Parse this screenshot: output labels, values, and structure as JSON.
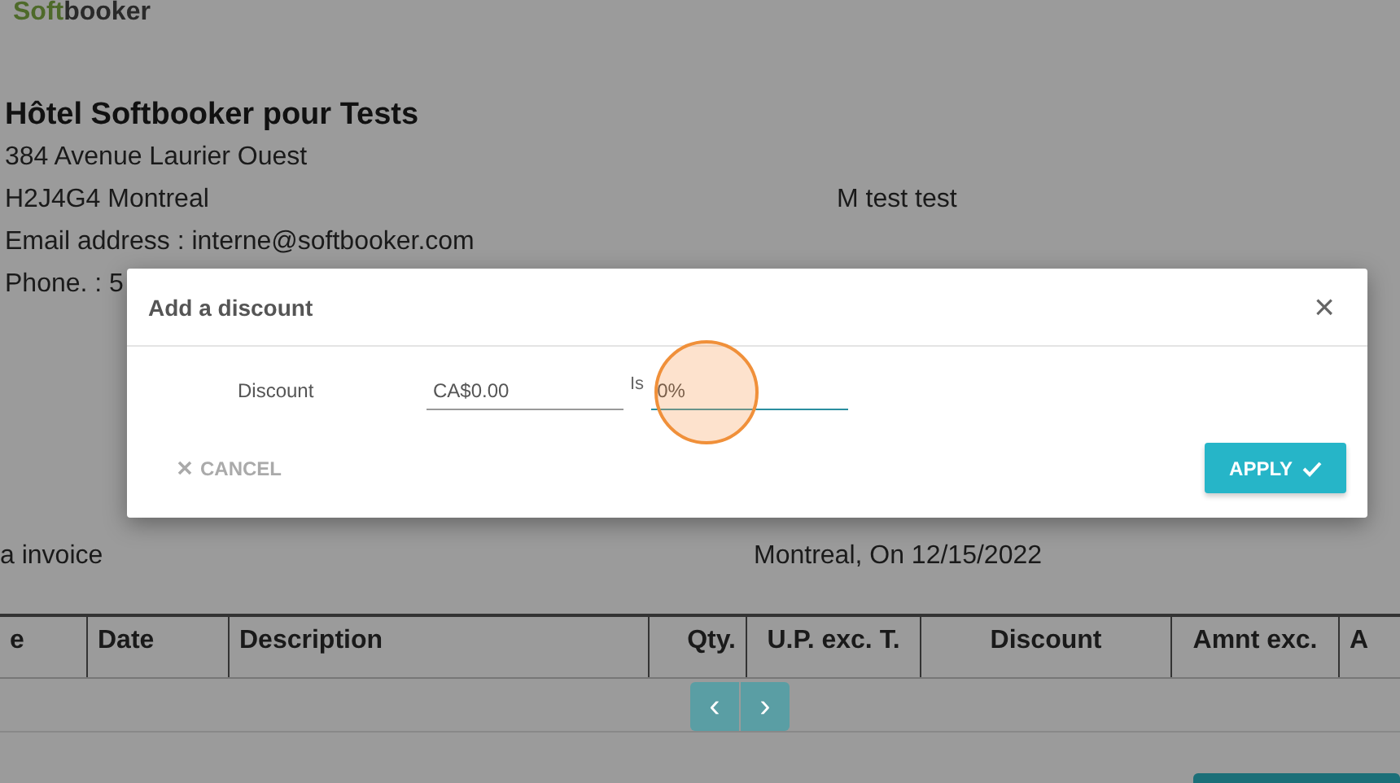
{
  "logo": {
    "part_1": "Soft",
    "part_2": "booker"
  },
  "hotel": {
    "name": "Hôtel Softbooker pour Tests",
    "lines": [
      "384 Avenue Laurier Ouest",
      "H2J4G4 Montreal",
      "Email address : interne@softbooker.com",
      "Phone. : 5"
    ]
  },
  "client": {
    "name": "M test test"
  },
  "invoice": {
    "title": "a invoice",
    "place_date": "Montreal, On 12/15/2022"
  },
  "table": {
    "columns": [
      "e",
      "Date",
      "Description",
      "Qty.",
      "U.P. exc. T.",
      "Discount",
      "Amnt exc.",
      "A"
    ]
  },
  "pager": {
    "prev": "‹",
    "next": "›"
  },
  "dialog": {
    "title": "Add a discount",
    "close": "×",
    "label": "Discount",
    "amount": {
      "value": "CA$0.00",
      "focused": false
    },
    "separator": "Is",
    "percent": {
      "value": "0%",
      "focused": true
    },
    "cancel": "CANCEL",
    "apply": "APPLY"
  }
}
